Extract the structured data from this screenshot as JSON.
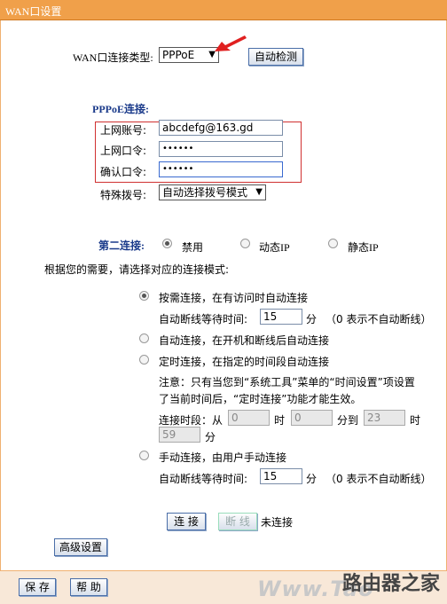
{
  "title": "WAN口设置",
  "wan_type": {
    "label": "WAN口连接类型:",
    "value": "PPPoE",
    "detect_button": "自动检测"
  },
  "pppoe": {
    "section_label": "PPPoE连接:",
    "account_label": "上网账号:",
    "account_value": "abcdefg@163.gd",
    "password_label": "上网口令:",
    "password_value": "••••••",
    "confirm_label": "确认口令:",
    "confirm_value": "••••••",
    "special_label": "特殊拨号:",
    "special_value": "自动选择拨号模式"
  },
  "second": {
    "label": "第二连接:",
    "opt_disable": "禁用",
    "opt_dynamic": "动态IP",
    "opt_static": "静态IP",
    "selected": "禁用"
  },
  "mode": {
    "intro": "根据您的需要，请选择对应的连接模式:",
    "on_demand": "按需连接，在有访问时自动连接",
    "idle_label": "自动断线等待时间:",
    "idle_value": "15",
    "minute": "分",
    "idle_note": "（0 表示不自动断线）",
    "auto": "自动连接，在开机和断线后自动连接",
    "timed": "定时连接，在指定的时间段自动连接",
    "note": "注意：只有当您到“系统工具”菜单的“时间设置”项设置",
    "note2": "了当前时间后，“定时连接”功能才能生效。",
    "period_label": "连接时段：从",
    "from_h": "0",
    "hour": "时",
    "from_m": "0",
    "to_label": "分到",
    "to_h": "23",
    "to_m": "59",
    "manual": "手动连接，由用户手动连接",
    "idle_label2": "自动断线等待时间:",
    "idle_value2": "15",
    "selected": "按需连接"
  },
  "actions": {
    "connect": "连 接",
    "disconnect": "断 线",
    "status": "未连接",
    "advanced": "高级设置"
  },
  "footer": {
    "save": "保 存",
    "help": "帮 助"
  },
  "watermark": {
    "site": "Www.Tao",
    "brand": "路由器之家"
  },
  "colors": {
    "title_bar": "#f0a04a",
    "section_text": "#1a3a8a",
    "highlight_box": "#d03030",
    "arrow": "#e02020"
  }
}
